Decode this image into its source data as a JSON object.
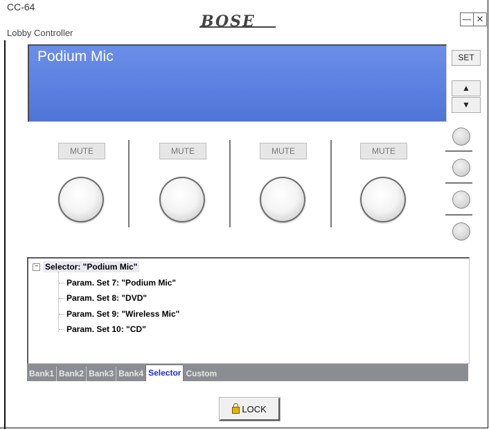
{
  "header": {
    "model": "CC-64",
    "subtitle": "Lobby Controller",
    "brand": "BOSE",
    "minimize_glyph": "—",
    "close_glyph": "✕"
  },
  "display": {
    "text": "Podium Mic",
    "color": "#5a7fe0"
  },
  "side_controls": {
    "set_label": "SET",
    "up_glyph": "▲",
    "down_glyph": "▼",
    "led_count": 4
  },
  "channels": [
    {
      "mute_label": "MUTE"
    },
    {
      "mute_label": "MUTE"
    },
    {
      "mute_label": "MUTE"
    },
    {
      "mute_label": "MUTE"
    }
  ],
  "tree": {
    "root": {
      "toggle": "−",
      "label": "Selector: \"Podium Mic\""
    },
    "children": [
      "Param. Set 7: \"Podium Mic\"",
      "Param. Set 8: \"DVD\"",
      "Param. Set 9: \"Wireless Mic\"",
      "Param. Set 10: \"CD\""
    ]
  },
  "tabs": [
    {
      "label": "Bank1",
      "active": false
    },
    {
      "label": "Bank2",
      "active": false
    },
    {
      "label": "Bank3",
      "active": false
    },
    {
      "label": "Bank4",
      "active": false
    },
    {
      "label": "Selector",
      "active": true
    },
    {
      "label": "Custom",
      "active": false
    }
  ],
  "lock": {
    "label": "LOCK",
    "icon": "lock-icon"
  }
}
